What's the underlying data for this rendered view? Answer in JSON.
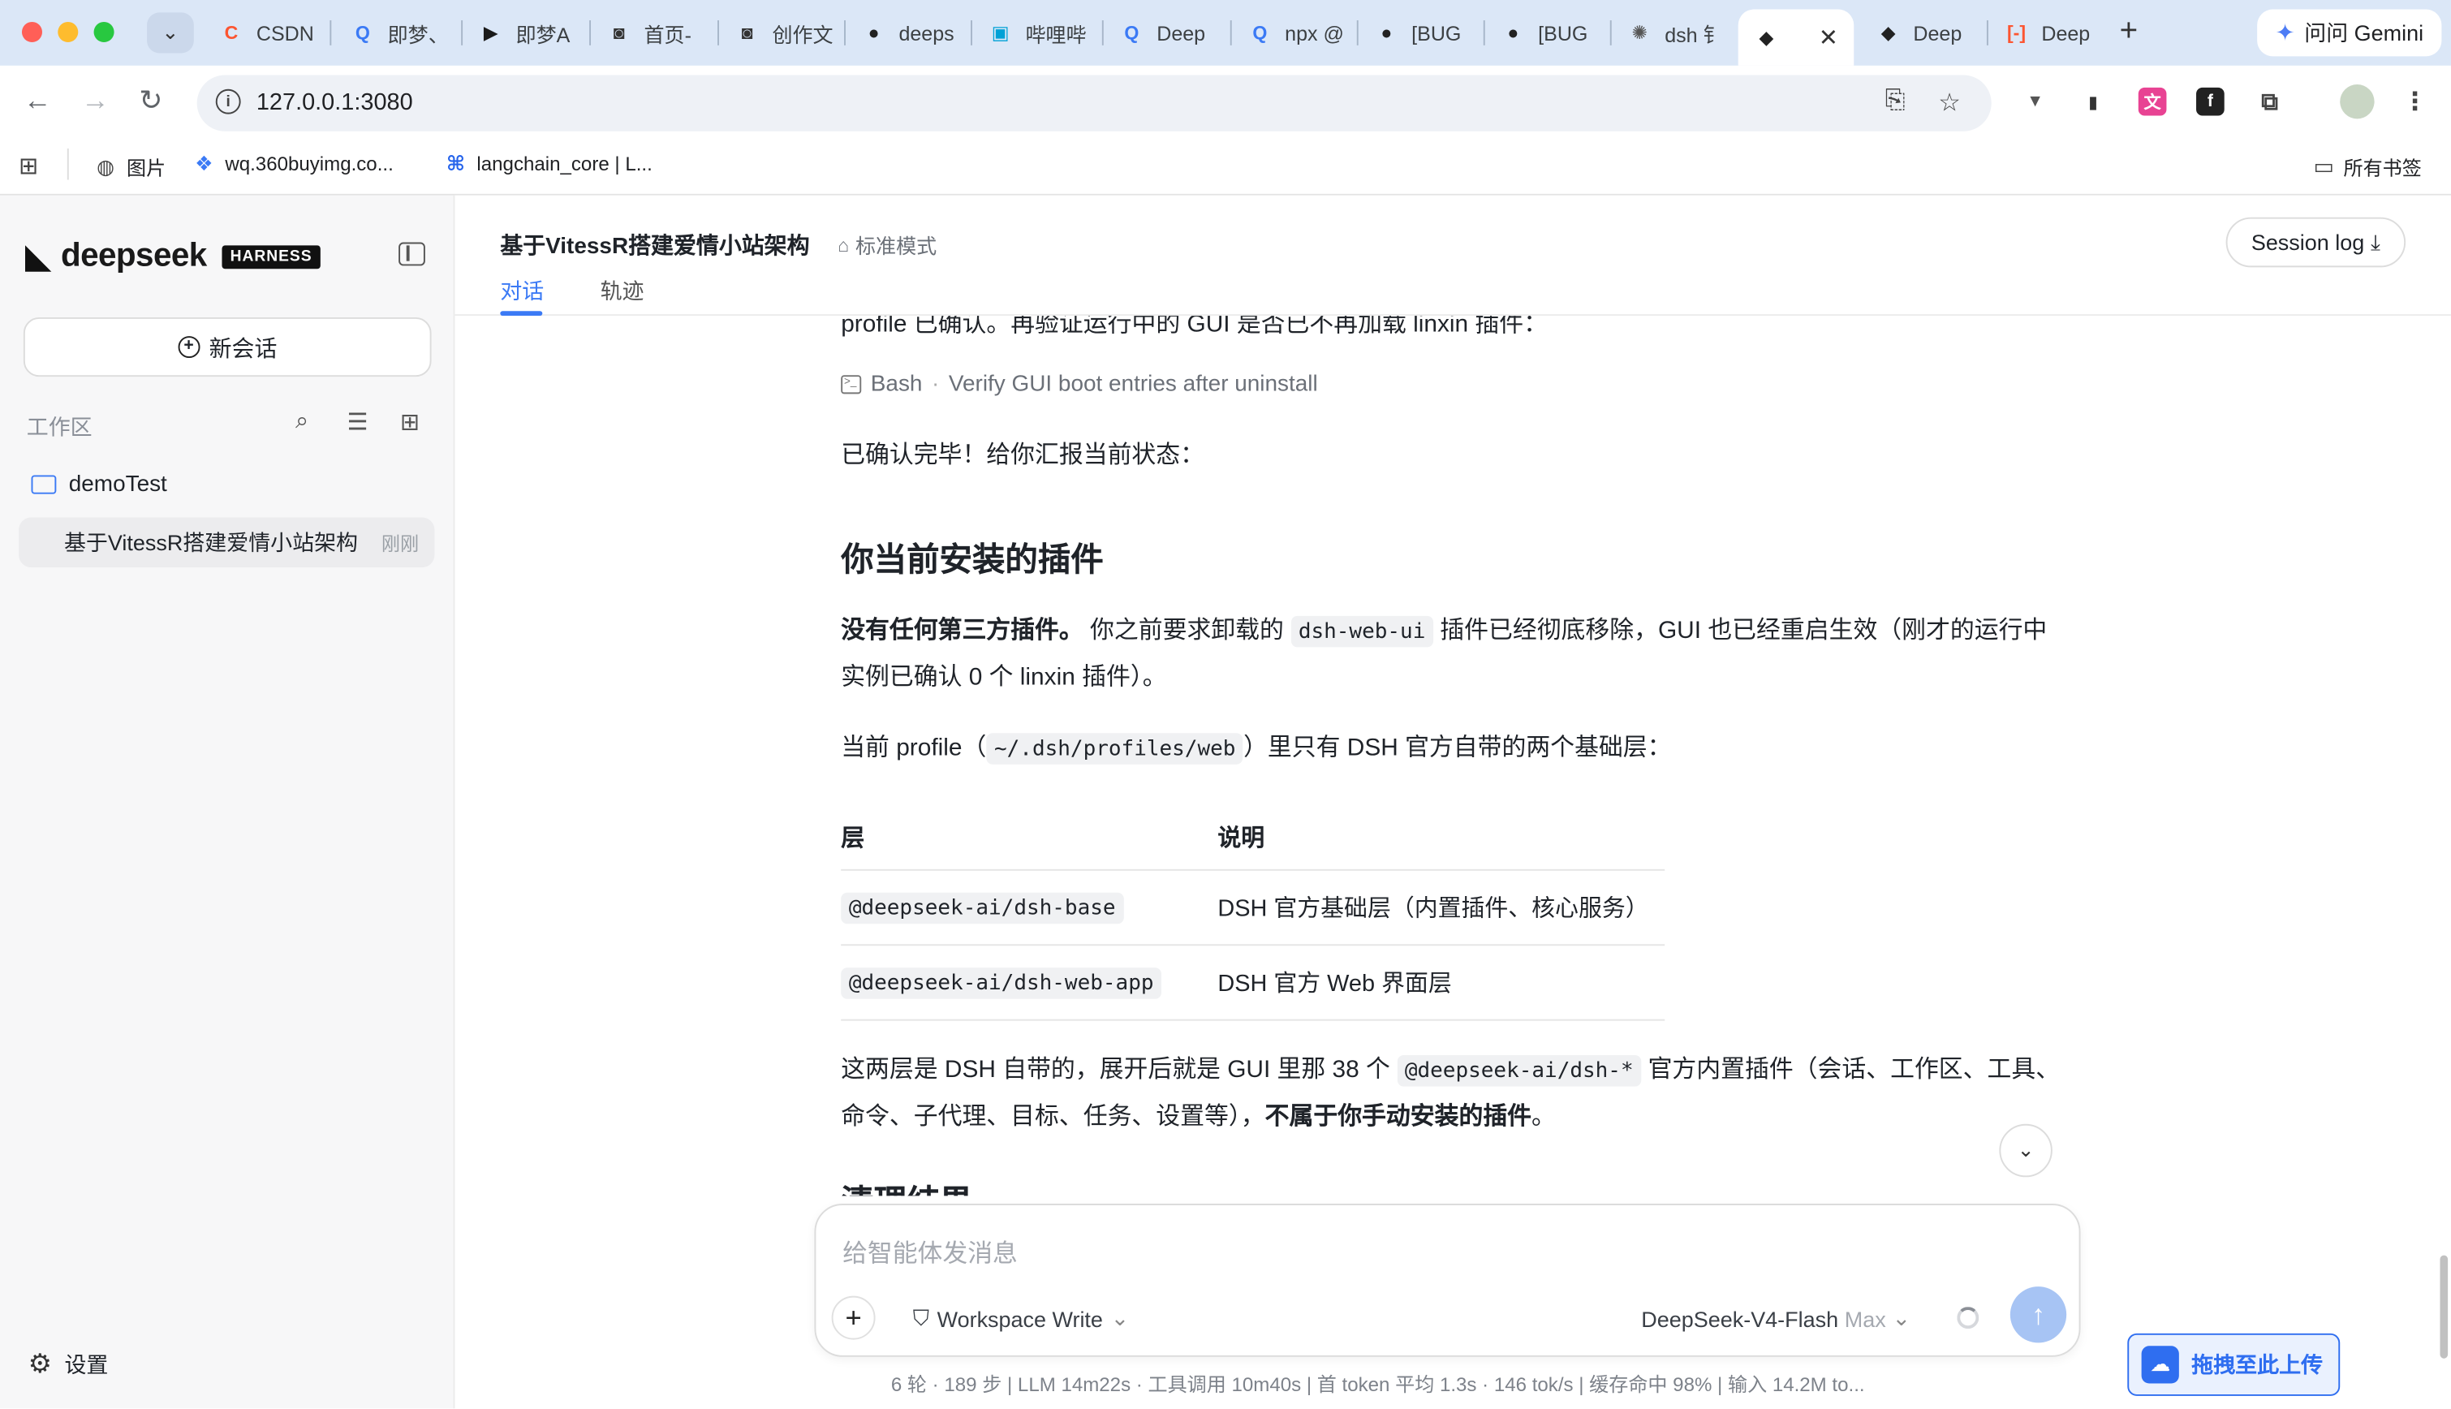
{
  "browser": {
    "tabs": [
      {
        "label": "CSDN",
        "color": "#fc5531",
        "glyph": "C"
      },
      {
        "label": "即梦、",
        "color": "#3b7af5",
        "glyph": "Q"
      },
      {
        "label": "即梦A",
        "color": "#1a1a1a",
        "glyph": "▶"
      },
      {
        "label": "首页-",
        "color": "#333333",
        "glyph": "◙"
      },
      {
        "label": "创作文",
        "color": "#333333",
        "glyph": "◙"
      },
      {
        "label": "deeps",
        "color": "#222222",
        "glyph": "●"
      },
      {
        "label": "哔哩哔",
        "color": "#00a1d6",
        "glyph": "▣"
      },
      {
        "label": "Deep",
        "color": "#3b7af5",
        "glyph": "Q"
      },
      {
        "label": "npx @",
        "color": "#3b7af5",
        "glyph": "Q"
      },
      {
        "label": "[BUG",
        "color": "#222222",
        "glyph": "●"
      },
      {
        "label": "[BUG",
        "color": "#222222",
        "glyph": "●"
      },
      {
        "label": "dsh 钅",
        "color": "#555555",
        "glyph": "✺"
      },
      {
        "label": "​",
        "color": "#222222",
        "glyph": "◆",
        "active": true
      },
      {
        "label": "Deep",
        "color": "#222222",
        "glyph": "◆"
      },
      {
        "label": "Deep",
        "color": "#fc5531",
        "glyph": "[-]"
      }
    ],
    "gemini_label": "问问 Gemini",
    "url": "127.0.0.1:3080",
    "bookmarks": [
      {
        "label": "图片",
        "color": "#444444",
        "glyph": "◍"
      },
      {
        "label": "wq.360buyimg.co...",
        "color": "#3b7af5",
        "glyph": "❖"
      },
      {
        "label": "langchain_core | L...",
        "color": "#2563eb",
        "glyph": "⌘"
      }
    ],
    "all_bookmarks": "所有书签"
  },
  "sidebar": {
    "brand": "deepseek",
    "badge": "HARNESS",
    "new_chat": "新会话",
    "workspace_label": "工作区",
    "folder": "demoTest",
    "session_title": "基于VitessR搭建爱情小站架构",
    "session_time": "刚刚",
    "settings": "设置"
  },
  "header": {
    "title": "基于VitessR搭建爱情小站架构",
    "mode": "标准模式",
    "tab_chat": "对话",
    "tab_trace": "轨迹",
    "session_log": "Session log"
  },
  "content": {
    "cut_line": "profile 已确认。再验证运行中的 GUI 是否已不再加载 linxin 插件：",
    "bash_tool": "Bash",
    "bash_desc": "Verify GUI boot entries after uninstall",
    "confirm": "已确认完毕！给你汇报当前状态：",
    "heading": "你当前安装的插件",
    "p1_bold": "没有任何第三方插件。",
    "p1_a": " 你之前要求卸载的 ",
    "p1_code": "dsh-web-ui",
    "p1_b": " 插件已经彻底移除，GUI 也已经重启生效（刚才的运行中实例已确认 0 个 linxin 插件）。",
    "p2_a": "当前 profile（",
    "p2_code": "~/.dsh/profiles/web",
    "p2_b": "）里只有 DSH 官方自带的两个基础层：",
    "table": {
      "col1": "层",
      "col2": "说明",
      "rows": [
        {
          "layer": "@deepseek-ai/dsh-base",
          "desc": "DSH 官方基础层（内置插件、核心服务）"
        },
        {
          "layer": "@deepseek-ai/dsh-web-app",
          "desc": "DSH 官方 Web 界面层"
        }
      ]
    },
    "p3_a": "这两层是 DSH 自带的，展开后就是 GUI 里那 38 个 ",
    "p3_code": "@deepseek-ai/dsh-*",
    "p3_b": " 官方内置插件（会话、工作区、工具、命令、子代理、目标、任务、设置等），",
    "p3_bold": "不属于你手动安装的插件",
    "p3_end": "。",
    "cut_heading": "清理结果"
  },
  "composer": {
    "placeholder": "给智能体发消息",
    "permission": "Workspace Write",
    "model": "DeepSeek-V4-Flash",
    "model_tier": "Max"
  },
  "status": {
    "text": "6 轮 · 189 步   |   LLM 14m22s · 工具调用 10m40s   |   首 token 平均 1.3s · 146 tok/s   |   缓存命中 98%   |   输入 14.2M to..."
  },
  "upload": {
    "label": "拖拽至此上传"
  }
}
